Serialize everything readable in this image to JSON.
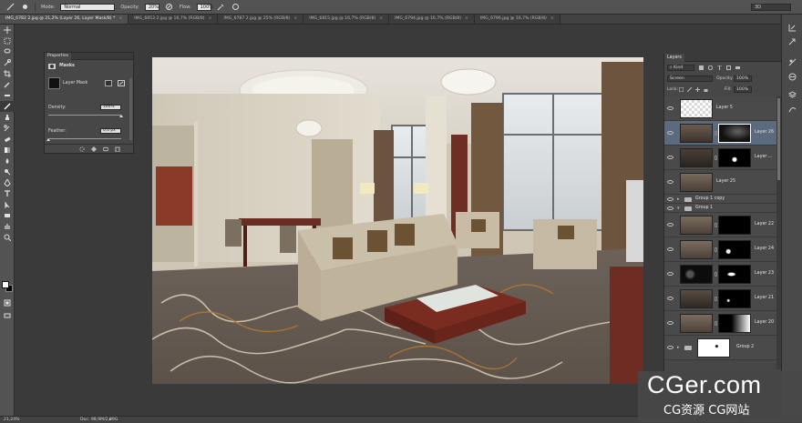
{
  "option_bar": {
    "mode_label": "Mode:",
    "mode_value": "Normal",
    "opacity_label": "Opacity:",
    "opacity_value": "20%",
    "flow_label": "Flow:",
    "flow_value": "100%",
    "workspace_value": "3D"
  },
  "tabs": [
    {
      "label": "IMG_6782 2.jpg @ 21,2% (Layer 26, Layer Mask/8) *",
      "active": true
    },
    {
      "label": "IMG_6853 2.jpg @ 16,7% (RGB/8)",
      "active": false
    },
    {
      "label": "IMG_6787 2.jpg @ 25% (RGB/8)",
      "active": false
    },
    {
      "label": "IMG_6815.jpg @ 16,7% (RGB/8)",
      "active": false
    },
    {
      "label": "IMG_6794.jpg @ 16,7% (RGB/8)",
      "active": false
    },
    {
      "label": "IMG_6796.jpg @ 16,7% (RGB/8)",
      "active": false
    }
  ],
  "tools": [
    "move",
    "marquee",
    "lasso",
    "quick-select",
    "crop",
    "eyedropper",
    "healing",
    "brush",
    "clone-stamp",
    "history-brush",
    "eraser",
    "gradient",
    "blur",
    "dodge",
    "pen",
    "type",
    "path-select",
    "rectangle",
    "hand",
    "zoom"
  ],
  "properties": {
    "title": "Properties",
    "section": "Masks",
    "mask_label": "Layer Mask",
    "density_label": "Density:",
    "density_value": "100%",
    "density_level": 1.0,
    "feather_label": "Feather:",
    "feather_value": "0,0 px",
    "feather_level": 0.0
  },
  "layers_panel": {
    "title": "Layers",
    "kind_value": "Kind",
    "blend_value": "Screen",
    "opacity_label": "Opacity:",
    "opacity_value": "100%",
    "lock_label": "Lock:",
    "fill_label": "Fill:",
    "fill_value": "100%",
    "layers": [
      {
        "name": "Layer 5",
        "type": "layer",
        "selected": false,
        "mask": false,
        "thumb": "transparent"
      },
      {
        "name": "Layer 26",
        "type": "layer",
        "selected": true,
        "mask": true,
        "thumb": "room",
        "mask_thumb": "black-lightspot"
      },
      {
        "name": "Layer ...",
        "type": "layer",
        "selected": false,
        "mask": true,
        "thumb": "room-dark",
        "mask_thumb": "black-dot"
      },
      {
        "name": "Layer 25",
        "type": "layer",
        "selected": false,
        "mask": false,
        "thumb": "room"
      },
      {
        "name": "Group 1 copy",
        "type": "group",
        "selected": false
      },
      {
        "name": "Group 1",
        "type": "group",
        "selected": false
      },
      {
        "name": "Layer 22",
        "type": "layer",
        "selected": false,
        "mask": true,
        "thumb": "room",
        "mask_thumb": "black"
      },
      {
        "name": "Layer 24",
        "type": "layer",
        "selected": false,
        "mask": true,
        "thumb": "room",
        "mask_thumb": "black-dot"
      },
      {
        "name": "Layer 23",
        "type": "layer",
        "selected": false,
        "mask": true,
        "thumb": "dark",
        "mask_thumb": "black-white-spot"
      },
      {
        "name": "Layer 21",
        "type": "layer",
        "selected": false,
        "mask": true,
        "thumb": "room-dark",
        "mask_thumb": "black-dot"
      },
      {
        "name": "Layer 20",
        "type": "layer",
        "selected": false,
        "mask": true,
        "thumb": "room",
        "mask_thumb": "gradient"
      },
      {
        "name": "Group 2",
        "type": "group-mask",
        "selected": false
      }
    ]
  },
  "status_bar": {
    "zoom": "21,24%",
    "doc": "Doc: 98,9M/2,09G"
  },
  "watermark": {
    "main": "CGer.com",
    "sub": "CG资源 CG网站"
  }
}
